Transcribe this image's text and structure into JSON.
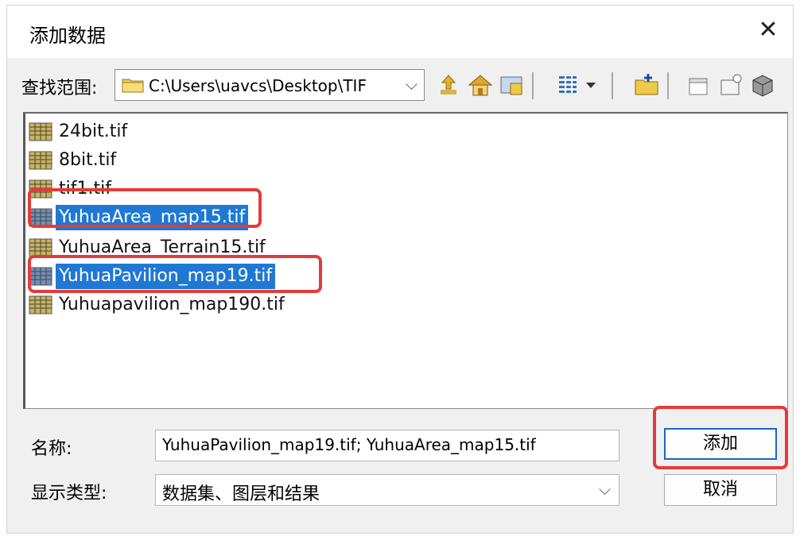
{
  "window": {
    "title": "添加数据",
    "close_symbol": "✕"
  },
  "lookin": {
    "label": "查找范围:",
    "path": "C:\\Users\\uavcs\\Desktop\\TIF",
    "chevron": "⌵"
  },
  "toolbar": {
    "icons": [
      "up-folder-icon",
      "home-icon",
      "connect-folder-icon",
      "view-list-icon",
      "dropdown-arrow-icon",
      "new-folder-icon",
      "new-item-icon",
      "new-layer-icon",
      "database-icon"
    ]
  },
  "files": [
    {
      "name": "24bit.tif",
      "selected": false
    },
    {
      "name": "8bit.tif",
      "selected": false
    },
    {
      "name": "tif1.tif",
      "selected": false
    },
    {
      "name": "YuhuaArea_map15.tif",
      "selected": true
    },
    {
      "name": "YuhuaArea_Terrain15.tif",
      "selected": false
    },
    {
      "name": "YuhuaPavilion_map19.tif",
      "selected": true
    },
    {
      "name": "Yuhuapavilion_map190.tif",
      "selected": false
    }
  ],
  "form": {
    "name_label": "名称:",
    "name_value": "YuhuaPavilion_map19.tif; YuhuaArea_map15.tif",
    "type_label": "显示类型:",
    "type_value": "数据集、图层和结果",
    "type_chevron": "⌵"
  },
  "buttons": {
    "add": "添加",
    "cancel": "取消"
  },
  "colors": {
    "selection": "#1f78d4",
    "highlight": "#e33b3b"
  }
}
